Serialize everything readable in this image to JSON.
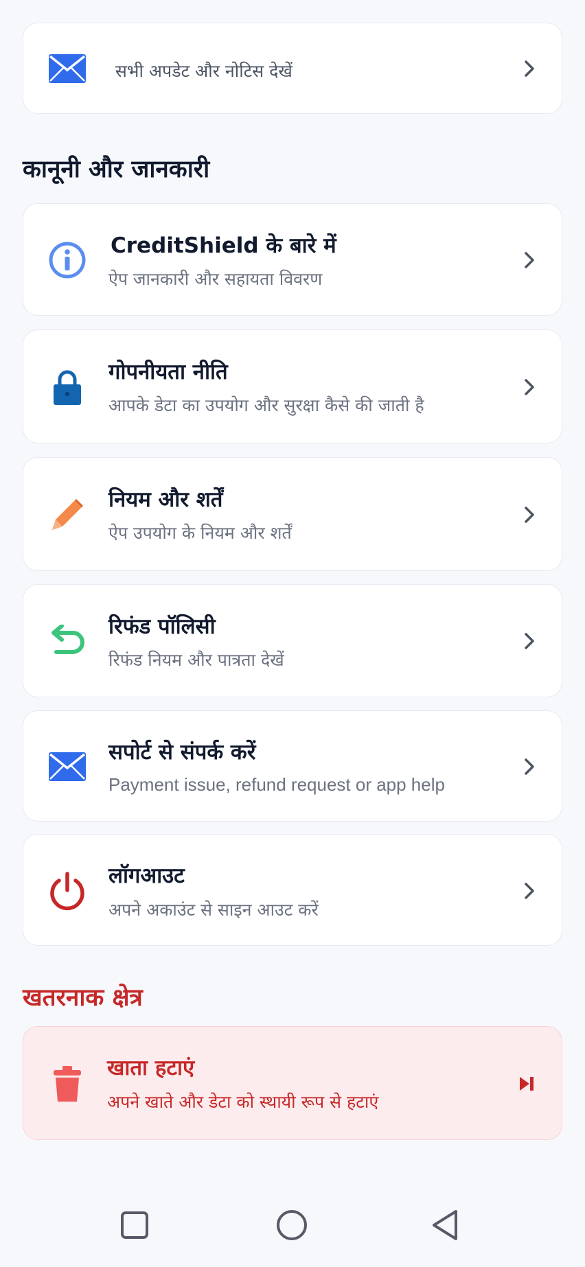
{
  "notices": {
    "subtitle": "सभी अपडेट और नोटिस देखें",
    "icon": "mail-icon"
  },
  "legal_section": {
    "title": "कानूनी और जानकारी",
    "items": [
      {
        "title": "CreditShield के बारे में",
        "subtitle": "ऐप जानकारी और सहायता विवरण",
        "icon": "info-icon"
      },
      {
        "title": "गोपनीयता नीति",
        "subtitle": "आपके डेटा का उपयोग और सुरक्षा कैसे की जाती है",
        "icon": "lock-icon"
      },
      {
        "title": "नियम और शर्तें",
        "subtitle": "ऐप उपयोग के नियम और शर्तें",
        "icon": "pencil-icon"
      },
      {
        "title": "रिफंड पॉलिसी",
        "subtitle": "रिफंड नियम और पात्रता देखें",
        "icon": "undo-arrow-icon"
      },
      {
        "title": "सपोर्ट से संपर्क करें",
        "subtitle": "Payment issue, refund request or app help",
        "icon": "mail-icon"
      },
      {
        "title": "लॉगआउट",
        "subtitle": "अपने अकाउंट से साइन आउट करें",
        "icon": "power-icon"
      }
    ]
  },
  "danger_section": {
    "title": "खतरनाक क्षेत्र",
    "item": {
      "title": "खाता हटाएं",
      "subtitle": "अपने खाते और डेटा को स्थायी रूप से हटाएं",
      "icon": "trash-icon"
    }
  },
  "colors": {
    "accent_blue": "#2f6bea",
    "danger_red": "#c62828",
    "danger_bg": "#fdecee",
    "success_green": "#3cc47c",
    "warning_orange": "#f5894a"
  },
  "navbar": {
    "icons": [
      "recent-apps-icon",
      "home-icon",
      "back-icon"
    ]
  }
}
